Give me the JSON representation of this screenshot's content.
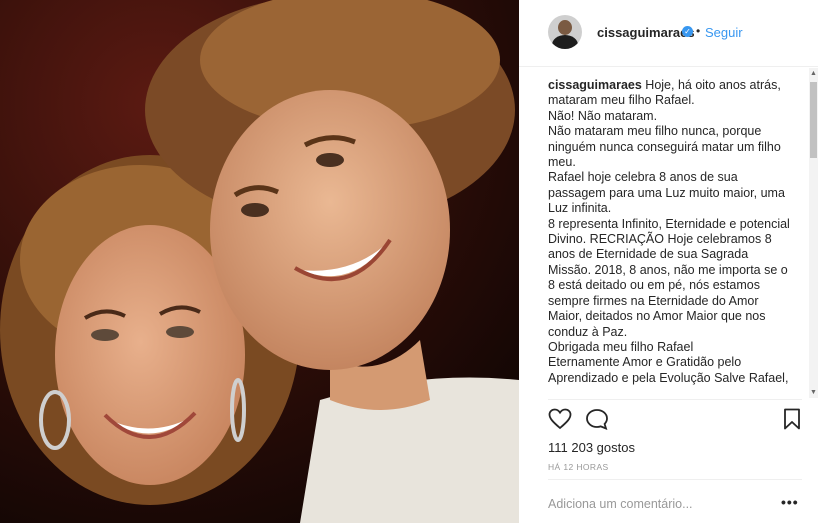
{
  "post": {
    "username": "cissaguimaraes",
    "follow_label": "Seguir",
    "dot": "•",
    "caption_lines": [
      "Hoje, há oito anos atrás, mataram meu filho Rafael.",
      "Não! Não mataram.",
      "Não mataram meu filho nunca, porque ninguém nunca conseguirá matar um filho meu.",
      "Rafael hoje celebra 8 anos de sua passagem para uma Luz muito maior, uma Luz infinita.",
      "8 representa Infinito, Eternidade e potencial Divino. RECRIAÇÃO Hoje celebramos 8 anos de Eternidade de sua Sagrada Missão. 2018, 8 anos, não me importa se o 8 está deitado ou em pé, nós estamos sempre firmes na Eternidade do Amor Maior, deitados no Amor Maior que nos conduz à Paz.",
      "Obrigada meu filho Rafael",
      "Eternamente Amor e Gratidão pelo Aprendizado e pela Evolução Salve Rafael,"
    ],
    "likes": "111 203 gostos",
    "time": "HÁ 12 HORAS",
    "comment_placeholder": "Adiciona um comentário...",
    "more": "•••"
  },
  "icons": {
    "like": "heart-outline-icon",
    "comment": "comment-bubble-icon",
    "save": "bookmark-icon",
    "verified": "verified-badge-icon"
  },
  "colors": {
    "link": "#3897f0",
    "text": "#262626",
    "muted": "#999999"
  }
}
